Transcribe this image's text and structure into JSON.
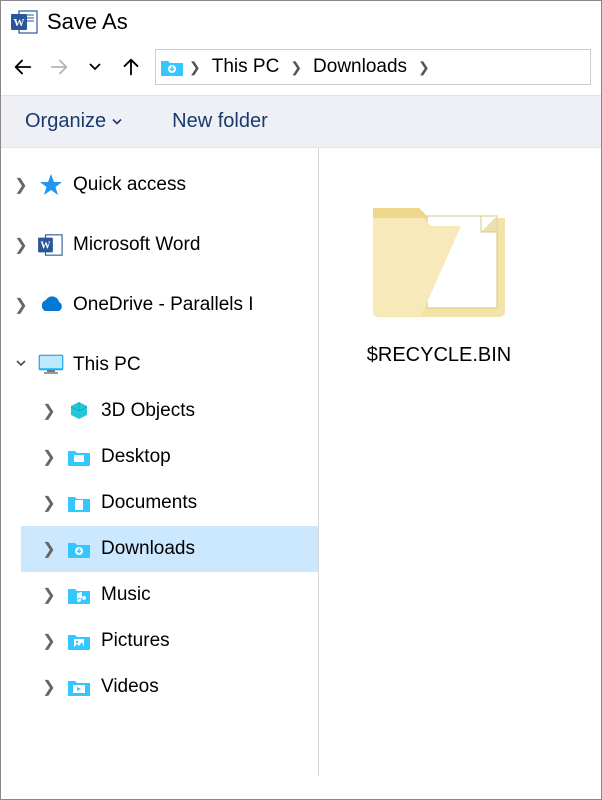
{
  "window": {
    "title": "Save As"
  },
  "breadcrumb": {
    "segments": [
      "This PC",
      "Downloads"
    ]
  },
  "toolbar": {
    "organize_label": "Organize",
    "newfolder_label": "New folder"
  },
  "tree": {
    "quick_access": "Quick access",
    "ms_word": "Microsoft Word",
    "onedrive": "OneDrive - Parallels I",
    "this_pc": "This PC",
    "children": {
      "objects3d": "3D Objects",
      "desktop": "Desktop",
      "documents": "Documents",
      "downloads": "Downloads",
      "music": "Music",
      "pictures": "Pictures",
      "videos": "Videos"
    }
  },
  "content": {
    "items": [
      {
        "name": "$RECYCLE.BIN",
        "type": "folder"
      }
    ]
  }
}
